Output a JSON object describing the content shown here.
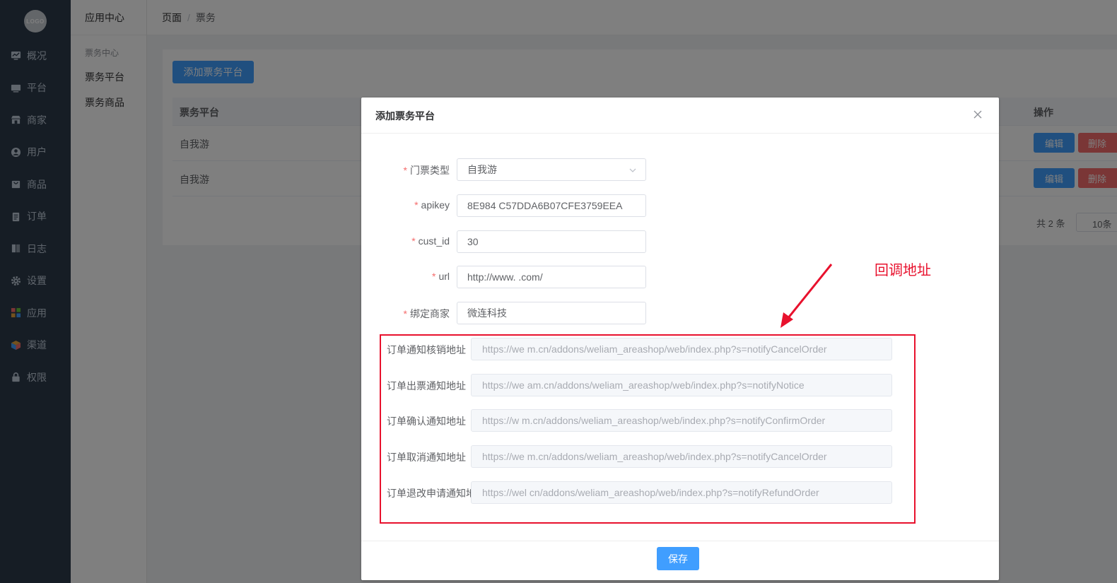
{
  "logo": {
    "text": "LOGO"
  },
  "nav": [
    {
      "label": "概况",
      "icon": "monitor-icon"
    },
    {
      "label": "平台",
      "icon": "desktop-icon"
    },
    {
      "label": "商家",
      "icon": "store-icon"
    },
    {
      "label": "用户",
      "icon": "user-icon"
    },
    {
      "label": "商品",
      "icon": "bag-icon"
    },
    {
      "label": "订单",
      "icon": "clipboard-icon"
    },
    {
      "label": "日志",
      "icon": "book-icon"
    },
    {
      "label": "设置",
      "icon": "gear-icon"
    },
    {
      "label": "应用",
      "icon": "apps-icon"
    },
    {
      "label": "渠道",
      "icon": "cube-icon"
    },
    {
      "label": "权限",
      "icon": "lock-icon"
    }
  ],
  "subbar": {
    "title": "应用中心",
    "group": "票务中心",
    "items": [
      "票务平台",
      "票务商品"
    ]
  },
  "breadcrumb": {
    "first": "页面",
    "separator": "/",
    "second": "票务"
  },
  "main": {
    "add_button": "添加票务平台",
    "columns": {
      "platform": "票务平台",
      "action": "操作"
    },
    "rows": [
      {
        "platform": "自我游"
      },
      {
        "platform": "自我游"
      }
    ],
    "edit_label": "编辑",
    "delete_label": "删除",
    "pager": {
      "total": "共 2 条",
      "size": "10条"
    }
  },
  "dialog": {
    "title": "添加票务平台",
    "fields": [
      {
        "label": "门票类型",
        "value": "自我游",
        "required": true,
        "type": "select"
      },
      {
        "label": "apikey",
        "value": "8E984          C57DDA6B07CFE3759EEA",
        "required": true
      },
      {
        "label": "cust_id",
        "value": "30",
        "required": true
      },
      {
        "label": "url",
        "value": "http://www.          .com/",
        "required": true
      },
      {
        "label": "绑定商家",
        "value": "微连科技",
        "required": true
      }
    ],
    "callbacks": [
      {
        "label": "订单通知核销地址",
        "value": "https://we          m.cn/addons/weliam_areashop/web/index.php?s=notifyCancelOrder"
      },
      {
        "label": "订单出票通知地址",
        "value": "https://we          am.cn/addons/weliam_areashop/web/index.php?s=notifyNotice"
      },
      {
        "label": "订单确认通知地址",
        "value": "https://w          m.cn/addons/weliam_areashop/web/index.php?s=notifyConfirmOrder"
      },
      {
        "label": "订单取消通知地址",
        "value": "https://we          m.cn/addons/weliam_areashop/web/index.php?s=notifyCancelOrder"
      },
      {
        "label": "订单退改申请通知地址",
        "value": "https://wel          cn/addons/weliam_areashop/web/index.php?s=notifyRefundOrder"
      }
    ],
    "save_label": "保存"
  },
  "annotation": {
    "text": "回调地址",
    "color": "#e8112d"
  },
  "colors": {
    "primary": "#409eff",
    "danger": "#f56c6c",
    "sidebar": "#2d3a4b"
  }
}
